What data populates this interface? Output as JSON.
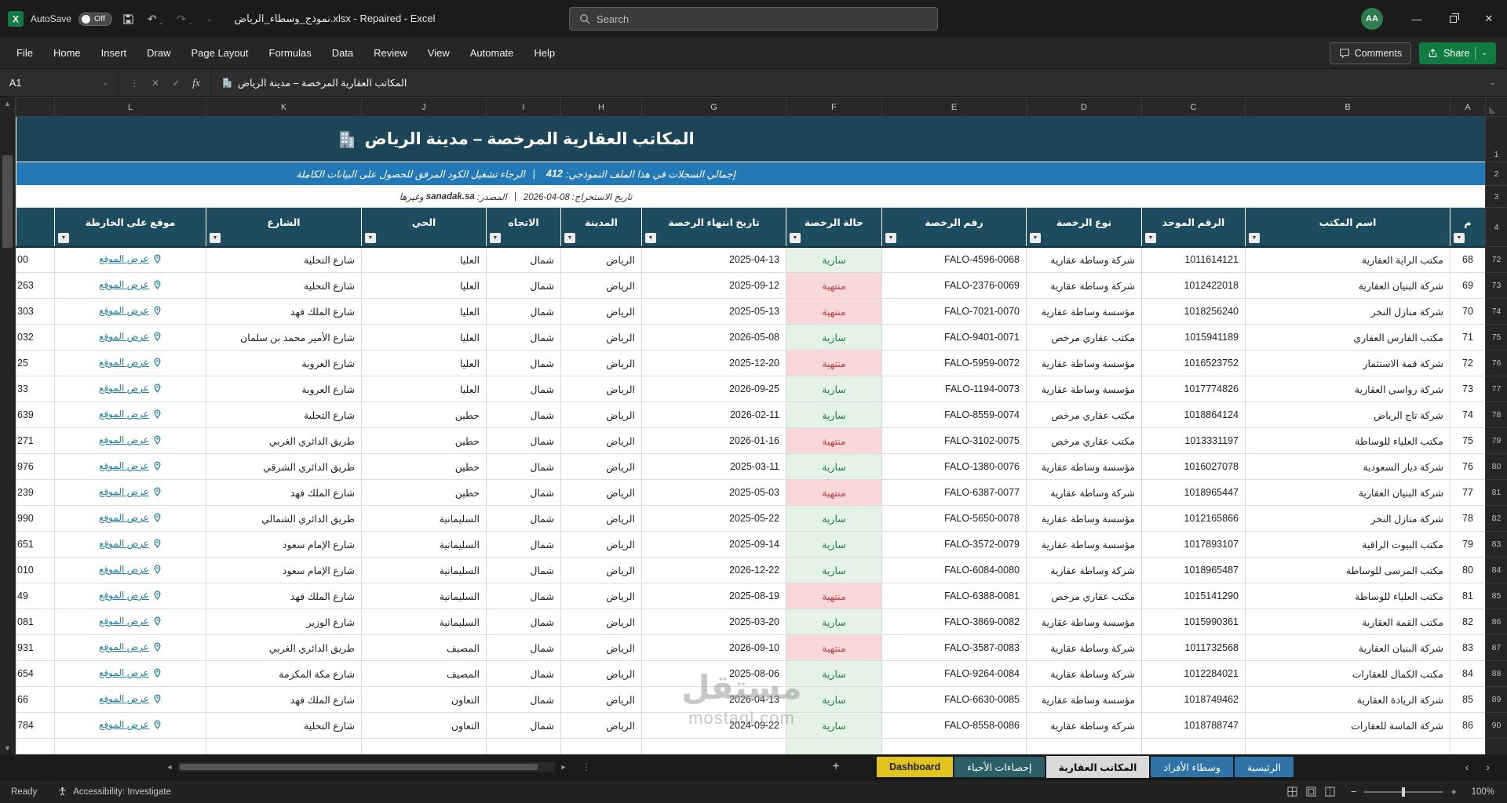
{
  "window": {
    "autosave_label": "AutoSave",
    "autosave_state": "Off",
    "title": "نموذج_وسطاء_الرياض.xlsx - Repaired - Excel",
    "search_placeholder": "Search",
    "avatar_initials": "AA"
  },
  "icons": {
    "filter": "▼",
    "scroll_up": "▲",
    "scroll_down": "▼",
    "scroll_left": "◄",
    "scroll_right": "►",
    "tab_prev": "‹",
    "tab_next": "›",
    "undo": "↶",
    "redo": "↷",
    "dropdown": "⌄",
    "close": "✕",
    "minimize": "—",
    "check": "✓",
    "cancel": "✕",
    "dots": "⋮",
    "add_sheet": "+",
    "fx": "fx",
    "zoom_out": "−",
    "zoom_in": "+"
  },
  "colors": {
    "title_band": "#1C4557",
    "header_band": "#1D4B60",
    "info_band": "#2279B5",
    "valid_bg": "#E4F3E6",
    "valid_text": "#237C3D",
    "expired_bg": "#F8D8D8",
    "expired_text": "#BF4040",
    "link": "#1E7FA8",
    "share_green": "#107C41",
    "tab_yellow": "#E2C21C",
    "tab_teal": "#2B5F66",
    "tab_blue": "#2F74A8",
    "tab_active": "#D9D9D9",
    "avatar_green": "#2E7D4F"
  },
  "ribbon": {
    "tabs": [
      "File",
      "Home",
      "Insert",
      "Draw",
      "Page Layout",
      "Formulas",
      "Data",
      "Review",
      "View",
      "Automate",
      "Help"
    ],
    "comments_label": "Comments",
    "share_label": "Share"
  },
  "formula_bar": {
    "name_box": "A1",
    "content": "المكاتب العقارية المرخصة – مدينة الرياض"
  },
  "grid": {
    "column_letters": [
      "A",
      "B",
      "C",
      "D",
      "E",
      "F",
      "G",
      "H",
      "I",
      "J",
      "K",
      "L"
    ],
    "frozen_row_numbers": [
      "1",
      "2",
      "3",
      "4"
    ],
    "title_text": "المكاتب العقارية المرخصة – مدينة الرياض",
    "info_prefix": "إجمالي السجلات في هذا الملف النموذجي:",
    "info_count": "412",
    "info_divider": "|",
    "info_suffix": "الرجاء تشغيل الكود المرفق للحصول على البيانات الكاملة",
    "source_date": "تاريخ الاستخراج: 08-04-2026",
    "source_divider": "|",
    "source_prefix": "المصدر:",
    "source_site": "sanadak.sa",
    "source_suffix": "وغيرها",
    "headers": [
      "م",
      "اسم المكتب",
      "الرقم الموحد",
      "نوع الرخصة",
      "رقم الرخصة",
      "حالة الرخصة",
      "تاريخ انتهاء الرخصة",
      "المدينة",
      "الاتجاه",
      "الحي",
      "الشارع",
      "موقع على الخارطة"
    ],
    "link_label": "عرض الموقع",
    "status_valid": "سارية",
    "status_expired": "منتهية",
    "rows": [
      {
        "n": "72",
        "num": "68",
        "office": "مكتب الراية العقارية",
        "unified": "1011614121",
        "type": "شركة وساطة عقارية",
        "license": "FALO-4596-0068",
        "status": "سارية",
        "expiry": "2025-04-13",
        "city": "الرياض",
        "dir": "شمال",
        "district": "العليا",
        "street": "شارع التحلية",
        "partial": "00"
      },
      {
        "n": "73",
        "num": "69",
        "office": "شركة البنيان العقارية",
        "unified": "1012422018",
        "type": "شركة وساطة عقارية",
        "license": "FALO-2376-0069",
        "status": "منتهية",
        "expiry": "2025-09-12",
        "city": "الرياض",
        "dir": "شمال",
        "district": "العليا",
        "street": "شارع التحلية",
        "partial": "263"
      },
      {
        "n": "74",
        "num": "70",
        "office": "شركة منازل النخر",
        "unified": "1018256240",
        "type": "مؤسسة وساطة عقارية",
        "license": "FALO-7021-0070",
        "status": "منتهية",
        "expiry": "2025-05-13",
        "city": "الرياض",
        "dir": "شمال",
        "district": "العليا",
        "street": "شارع الملك فهد",
        "partial": "303"
      },
      {
        "n": "75",
        "num": "71",
        "office": "مكتب الفارس العقاري",
        "unified": "1015941189",
        "type": "مكتب عقاري مرخص",
        "license": "FALO-9401-0071",
        "status": "سارية",
        "expiry": "2026-05-08",
        "city": "الرياض",
        "dir": "شمال",
        "district": "العليا",
        "street": "شارع الأمير محمد بن سلمان",
        "partial": "032"
      },
      {
        "n": "76",
        "num": "72",
        "office": "شركة قمة الاستثمار",
        "unified": "1016523752",
        "type": "مؤسسة وساطة عقارية",
        "license": "FALO-5959-0072",
        "status": "منتهية",
        "expiry": "2025-12-20",
        "city": "الرياض",
        "dir": "شمال",
        "district": "العليا",
        "street": "شارع العروبة",
        "partial": "25"
      },
      {
        "n": "77",
        "num": "73",
        "office": "شركة رواسي العقارية",
        "unified": "1017774826",
        "type": "مؤسسة وساطة عقارية",
        "license": "FALO-1194-0073",
        "status": "سارية",
        "expiry": "2026-09-25",
        "city": "الرياض",
        "dir": "شمال",
        "district": "العليا",
        "street": "شارع العروبة",
        "partial": "33"
      },
      {
        "n": "78",
        "num": "74",
        "office": "شركة تاج الرياض",
        "unified": "1018864124",
        "type": "مكتب عقاري مرخص",
        "license": "FALO-8559-0074",
        "status": "سارية",
        "expiry": "2026-02-11",
        "city": "الرياض",
        "dir": "شمال",
        "district": "حطين",
        "street": "شارع التحلية",
        "partial": "639"
      },
      {
        "n": "79",
        "num": "75",
        "office": "مكتب العلياء للوساطة",
        "unified": "1013331197",
        "type": "مكتب عقاري مرخص",
        "license": "FALO-3102-0075",
        "status": "منتهية",
        "expiry": "2026-01-16",
        "city": "الرياض",
        "dir": "شمال",
        "district": "حطين",
        "street": "طريق الدائري الغربي",
        "partial": "271"
      },
      {
        "n": "80",
        "num": "76",
        "office": "شركة ديار السعودية",
        "unified": "1016027078",
        "type": "مؤسسة وساطة عقارية",
        "license": "FALO-1380-0076",
        "status": "سارية",
        "expiry": "2025-03-11",
        "city": "الرياض",
        "dir": "شمال",
        "district": "حطين",
        "street": "طريق الدائري الشرقي",
        "partial": "976"
      },
      {
        "n": "81",
        "num": "77",
        "office": "شركة البنيان العقارية",
        "unified": "1018965447",
        "type": "شركة وساطة عقارية",
        "license": "FALO-6387-0077",
        "status": "منتهية",
        "expiry": "2025-05-03",
        "city": "الرياض",
        "dir": "شمال",
        "district": "حطين",
        "street": "شارع الملك فهد",
        "partial": "239"
      },
      {
        "n": "82",
        "num": "78",
        "office": "شركة منازل النخر",
        "unified": "1012165866",
        "type": "مؤسسة وساطة عقارية",
        "license": "FALO-5650-0078",
        "status": "سارية",
        "expiry": "2025-05-22",
        "city": "الرياض",
        "dir": "شمال",
        "district": "السليمانية",
        "street": "طريق الدائري الشمالي",
        "partial": "990"
      },
      {
        "n": "83",
        "num": "79",
        "office": "مكتب البيوت الراقية",
        "unified": "1017893107",
        "type": "مؤسسة وساطة عقارية",
        "license": "FALO-3572-0079",
        "status": "سارية",
        "expiry": "2025-09-14",
        "city": "الرياض",
        "dir": "شمال",
        "district": "السليمانية",
        "street": "شارع الإمام سعود",
        "partial": "651"
      },
      {
        "n": "84",
        "num": "80",
        "office": "مكتب المرسى للوساطة",
        "unified": "1018965487",
        "type": "شركة وساطة عقارية",
        "license": "FALO-6084-0080",
        "status": "سارية",
        "expiry": "2026-12-22",
        "city": "الرياض",
        "dir": "شمال",
        "district": "السليمانية",
        "street": "شارع الإمام سعود",
        "partial": "010"
      },
      {
        "n": "85",
        "num": "81",
        "office": "مكتب العلياء للوساطة",
        "unified": "1015141290",
        "type": "مكتب عقاري مرخص",
        "license": "FALO-6388-0081",
        "status": "منتهية",
        "expiry": "2025-08-19",
        "city": "الرياض",
        "dir": "شمال",
        "district": "السليمانية",
        "street": "شارع الملك فهد",
        "partial": "49"
      },
      {
        "n": "86",
        "num": "82",
        "office": "مكتب القمة العقارية",
        "unified": "1015990361",
        "type": "مؤسسة وساطة عقارية",
        "license": "FALO-3869-0082",
        "status": "سارية",
        "expiry": "2025-03-20",
        "city": "الرياض",
        "dir": "شمال",
        "district": "السليمانية",
        "street": "شارع الوزير",
        "partial": "081"
      },
      {
        "n": "87",
        "num": "83",
        "office": "شركة البنيان العقارية",
        "unified": "1011732568",
        "type": "شركة وساطة عقارية",
        "license": "FALO-3587-0083",
        "status": "منتهية",
        "expiry": "2026-09-10",
        "city": "الرياض",
        "dir": "شمال",
        "district": "المصيف",
        "street": "طريق الدائري الغربي",
        "partial": "931"
      },
      {
        "n": "88",
        "num": "84",
        "office": "مكتب الكمال للعقارات",
        "unified": "1012284021",
        "type": "شركة وساطة عقارية",
        "license": "FALO-9264-0084",
        "status": "سارية",
        "expiry": "2025-08-06",
        "city": "الرياض",
        "dir": "شمال",
        "district": "المصيف",
        "street": "شارع مكة المكرمة",
        "partial": "654"
      },
      {
        "n": "89",
        "num": "85",
        "office": "شركة الريادة العقارية",
        "unified": "1018749462",
        "type": "مؤسسة وساطة عقارية",
        "license": "FALO-6630-0085",
        "status": "سارية",
        "expiry": "2026-04-13",
        "city": "الرياض",
        "dir": "شمال",
        "district": "التعاون",
        "street": "شارع الملك فهد",
        "partial": "66"
      },
      {
        "n": "90",
        "num": "86",
        "office": "شركة الماسة للعقارات",
        "unified": "1018788747",
        "type": "شركة وساطة عقارية",
        "license": "FALO-8558-0086",
        "status": "سارية",
        "expiry": "2024-09-22",
        "city": "الرياض",
        "dir": "شمال",
        "district": "التعاون",
        "street": "شارع التحلية",
        "partial": "784"
      }
    ]
  },
  "sheet_tabs": {
    "tabs": [
      {
        "label": "Dashboard",
        "style": "yellow",
        "active": false
      },
      {
        "label": "إحصاءات الأحياء",
        "style": "teal",
        "active": false
      },
      {
        "label": "المكاتب العقارية",
        "style": "active",
        "active": true
      },
      {
        "label": "وسطاء الأفراد",
        "style": "blue",
        "active": false
      },
      {
        "label": "الرئيسية",
        "style": "blue",
        "active": false
      }
    ]
  },
  "status_bar": {
    "ready": "Ready",
    "accessibility": "Accessibility: Investigate",
    "zoom": "100%"
  },
  "watermark": {
    "line1": "مستقل",
    "line2": "mostaql.com"
  }
}
